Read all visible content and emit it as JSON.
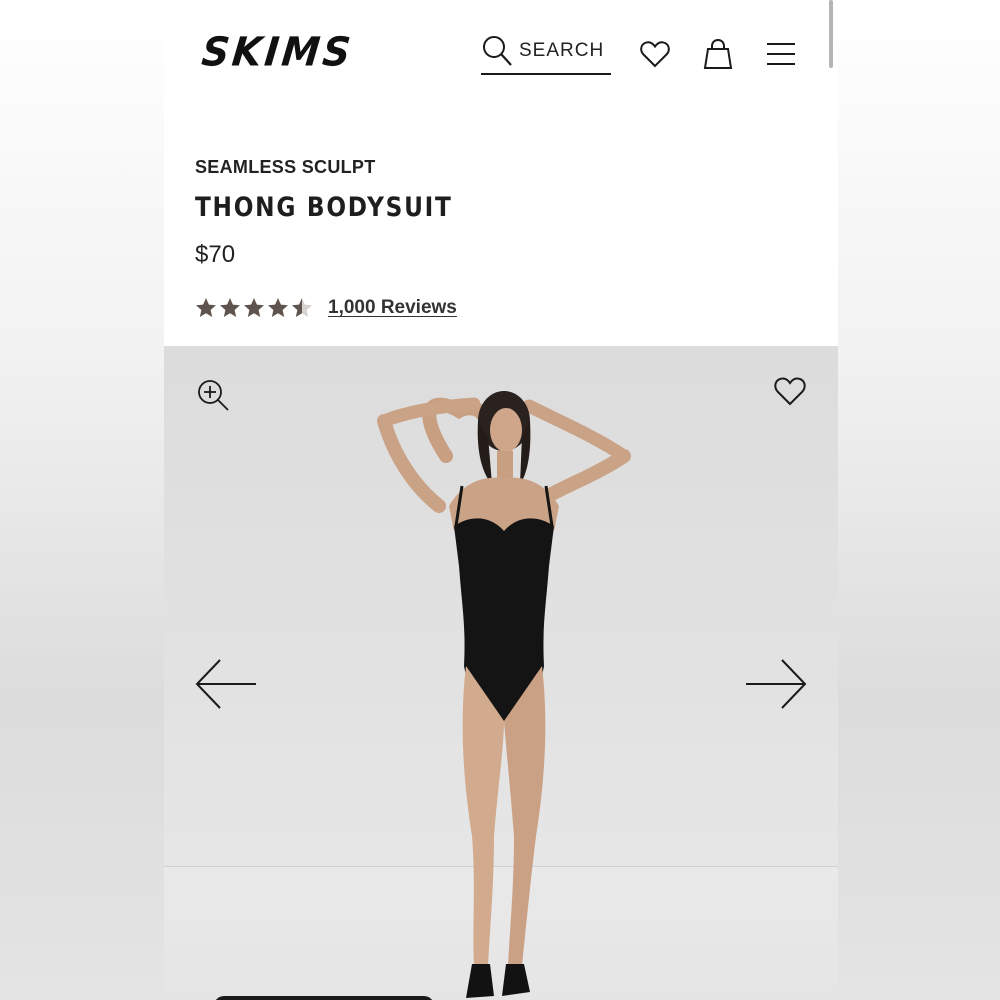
{
  "header": {
    "logo": "SKIMS",
    "search_label": "SEARCH"
  },
  "product": {
    "collection": "SEAMLESS SCULPT",
    "title": "THONG BODYSUIT",
    "price": "$70",
    "rating": 4.5,
    "reviews_label": "1,000 Reviews"
  },
  "icons": {
    "search": "search-icon",
    "wishlist": "heart-icon",
    "bag": "bag-icon",
    "menu": "hamburger-icon",
    "zoom": "zoom-in-icon",
    "prev": "arrow-left-icon",
    "next": "arrow-right-icon"
  },
  "colors": {
    "star": "#5e544d",
    "text": "#222222",
    "gallery_bg": "#e0e0e0"
  }
}
